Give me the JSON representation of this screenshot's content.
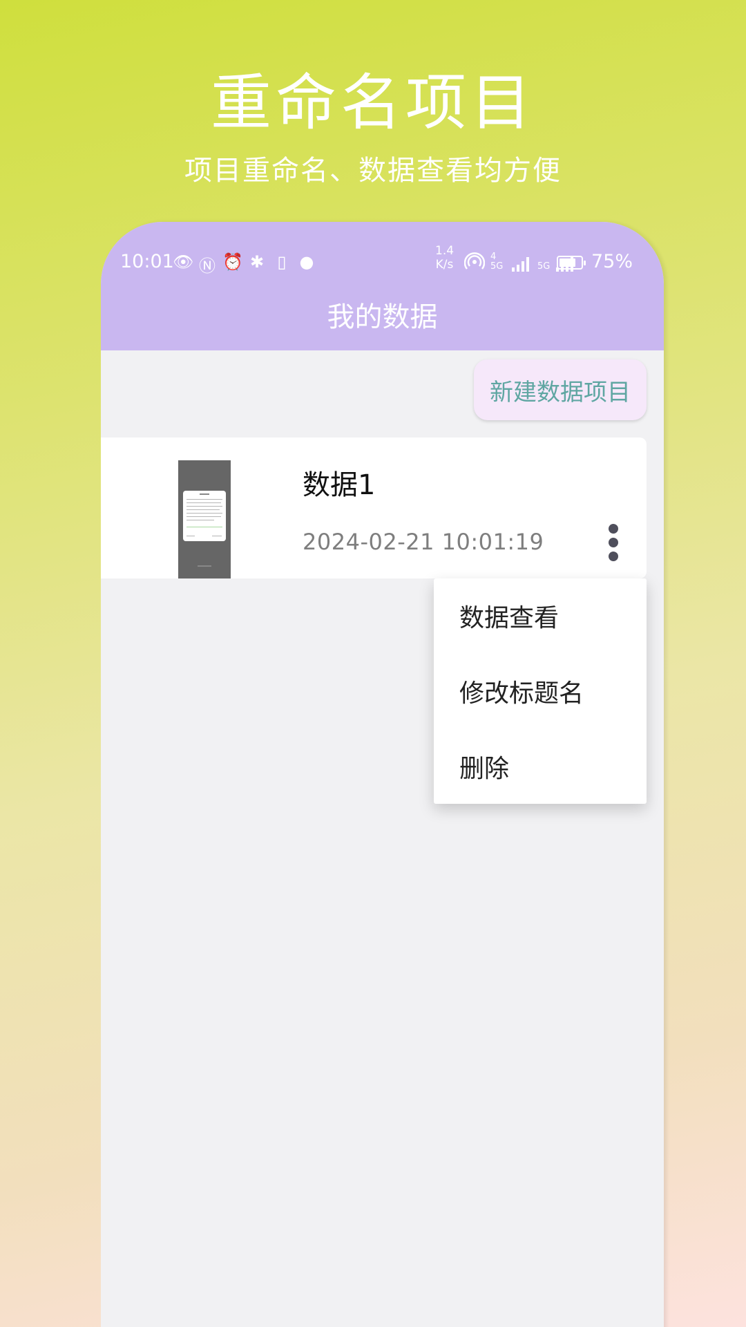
{
  "promo": {
    "title": "重命名项目",
    "subtitle": "项目重命名、数据查看均方便"
  },
  "status_bar": {
    "time": "10:01",
    "net_speed_value": "1.4",
    "net_speed_unit": "K/s",
    "sim1": "4 5G",
    "sim2": "5G",
    "battery_percent": "75%",
    "battery_level": 0.75,
    "icons": [
      "eye-icon",
      "nfc-icon",
      "alarm-icon",
      "bluetooth-battery-icon",
      "vibrate-icon",
      "globe-icon",
      "hotspot-icon",
      "signal-icon",
      "battery-icon"
    ]
  },
  "header": {
    "title": "我的数据"
  },
  "actions": {
    "new_project": "新建数据项目"
  },
  "projects": [
    {
      "title": "数据1",
      "date": "2024-02-21 10:01:19"
    }
  ],
  "menu": {
    "items": [
      "数据查看",
      "修改标题名",
      "删除"
    ]
  },
  "colors": {
    "header_bg": "#c9b7f0",
    "accent_text": "#5fa6a2",
    "new_btn_bg": "#f6e8fa"
  }
}
